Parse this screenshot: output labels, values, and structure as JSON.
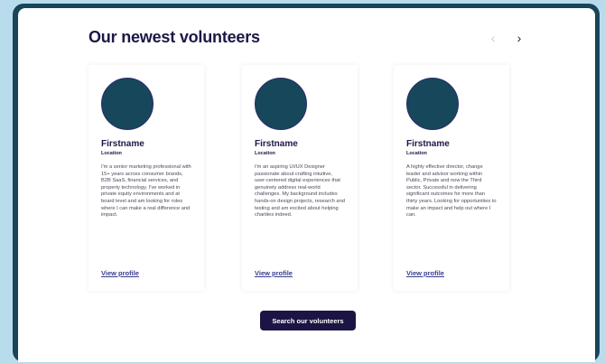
{
  "section": {
    "title": "Our newest volunteers",
    "prev_icon": "chevron-left-icon",
    "next_icon": "chevron-right-icon",
    "prev_glyph": "‹",
    "next_glyph": "›"
  },
  "volunteers": [
    {
      "name": "Firstname",
      "location": "Location",
      "bio": "I'm a senior marketing professional with 15+ years across consumer brands, B2B SaaS, financial services, and property technology. I've worked in private equity environments and at board level and am looking for roles where I can make a real difference and impact.",
      "link": "View profile"
    },
    {
      "name": "Firstname",
      "location": "Location",
      "bio": "I'm an aspiring UI/UX Designer passionate about crafting intuitive, user-centered digital experiences that genuinely address real-world challenges. My background includes hands-on design projects, research and testing and am excited about helping charities indeed.",
      "link": "View profile"
    },
    {
      "name": "Firstname",
      "location": "Location",
      "bio": "A highly effective director, change leader and advisor working within Public, Private and now the Third sector. Successful in delivering significant outcomes for more than thirty years. Looking for opportunities to make an impact and help out where I can.",
      "link": "View profile"
    }
  ],
  "cta": {
    "label": "Search our volunteers"
  },
  "colors": {
    "background": "#b9dcec",
    "frame": "#17465a",
    "avatar": "#16475a",
    "heading": "#1b1847",
    "button": "#1b1545",
    "link": "#3a3d8f"
  }
}
